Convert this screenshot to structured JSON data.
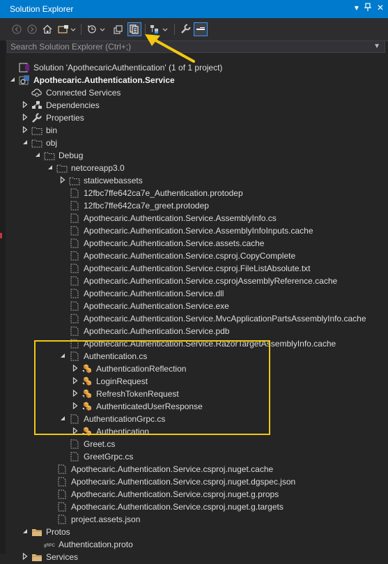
{
  "window": {
    "title": "Solution Explorer",
    "title_icons": [
      "dropdown-icon",
      "pin-icon",
      "close-icon"
    ]
  },
  "toolbar": {
    "items": [
      "back-icon",
      "forward-icon",
      "home-icon",
      "switch-views-icon",
      "pending-changes-filter-icon",
      "sync-with-active-document-icon",
      "collapse-all-icon",
      "show-all-files-icon",
      "properties-icon",
      "preview-selected-items-icon"
    ],
    "active_item": "show-all-files-icon"
  },
  "search": {
    "placeholder": "Search Solution Explorer (Ctrl+;)"
  },
  "tree": [
    {
      "label": "Solution 'ApothecaricAuthentication' (1 of 1 project)",
      "icon": "solution-icon",
      "expander": "none",
      "bold": false
    },
    {
      "label": "Apothecaric.Authentication.Service",
      "icon": "csharp-project-icon",
      "expander": "expanded",
      "bold": true
    },
    {
      "label": "Connected Services",
      "icon": "connected-services-icon",
      "expander": "none",
      "bold": false
    },
    {
      "label": "Dependencies",
      "icon": "dependencies-icon",
      "expander": "collapsed",
      "bold": false
    },
    {
      "label": "Properties",
      "icon": "wrench-icon",
      "expander": "collapsed",
      "bold": false
    },
    {
      "label": "bin",
      "icon": "folder-outline-icon",
      "expander": "collapsed",
      "bold": false
    },
    {
      "label": "obj",
      "icon": "folder-outline-icon",
      "expander": "expanded",
      "bold": false
    },
    {
      "label": "Debug",
      "icon": "folder-outline-icon",
      "expander": "expanded",
      "bold": false
    },
    {
      "label": "netcoreapp3.0",
      "icon": "folder-outline-icon",
      "expander": "expanded",
      "bold": false
    },
    {
      "label": "staticwebassets",
      "icon": "folder-outline-icon",
      "expander": "collapsed",
      "bold": false
    },
    {
      "label": "12fbc7ffe642ca7e_Authentication.protodep",
      "icon": "file-outline-icon",
      "expander": "none",
      "bold": false
    },
    {
      "label": "12fbc7ffe642ca7e_greet.protodep",
      "icon": "file-outline-icon",
      "expander": "none",
      "bold": false
    },
    {
      "label": "Apothecaric.Authentication.Service.AssemblyInfo.cs",
      "icon": "file-outline-icon",
      "expander": "none",
      "bold": false
    },
    {
      "label": "Apothecaric.Authentication.Service.AssemblyInfoInputs.cache",
      "icon": "file-outline-icon",
      "expander": "none",
      "bold": false
    },
    {
      "label": "Apothecaric.Authentication.Service.assets.cache",
      "icon": "file-outline-icon",
      "expander": "none",
      "bold": false
    },
    {
      "label": "Apothecaric.Authentication.Service.csproj.CopyComplete",
      "icon": "file-outline-icon",
      "expander": "none",
      "bold": false
    },
    {
      "label": "Apothecaric.Authentication.Service.csproj.FileListAbsolute.txt",
      "icon": "file-outline-icon",
      "expander": "none",
      "bold": false
    },
    {
      "label": "Apothecaric.Authentication.Service.csprojAssemblyReference.cache",
      "icon": "file-outline-icon",
      "expander": "none",
      "bold": false
    },
    {
      "label": "Apothecaric.Authentication.Service.dll",
      "icon": "file-outline-icon",
      "expander": "none",
      "bold": false
    },
    {
      "label": "Apothecaric.Authentication.Service.exe",
      "icon": "file-outline-icon",
      "expander": "none",
      "bold": false
    },
    {
      "label": "Apothecaric.Authentication.Service.MvcApplicationPartsAssemblyInfo.cache",
      "icon": "file-outline-icon",
      "expander": "none",
      "bold": false
    },
    {
      "label": "Apothecaric.Authentication.Service.pdb",
      "icon": "file-outline-icon",
      "expander": "none",
      "bold": false
    },
    {
      "label": "Apothecaric.Authentication.Service.RazorTargetAssemblyInfo.cache",
      "icon": "file-outline-icon",
      "expander": "none",
      "bold": false
    },
    {
      "label": "Authentication.cs",
      "icon": "file-outline-icon",
      "expander": "expanded",
      "bold": false
    },
    {
      "label": "AuthenticationReflection",
      "icon": "class-icon",
      "expander": "collapsed",
      "bold": false
    },
    {
      "label": "LoginRequest",
      "icon": "class-icon",
      "expander": "collapsed",
      "bold": false
    },
    {
      "label": "RefreshTokenRequest",
      "icon": "class-icon",
      "expander": "collapsed",
      "bold": false
    },
    {
      "label": "AuthenticatedUserResponse",
      "icon": "class-icon",
      "expander": "collapsed",
      "bold": false
    },
    {
      "label": "AuthenticationGrpc.cs",
      "icon": "file-outline-icon",
      "expander": "expanded",
      "bold": false
    },
    {
      "label": "Authentication",
      "icon": "class-icon",
      "expander": "collapsed",
      "bold": false
    },
    {
      "label": "Greet.cs",
      "icon": "file-outline-icon",
      "expander": "none",
      "bold": false
    },
    {
      "label": "GreetGrpc.cs",
      "icon": "file-outline-icon",
      "expander": "none",
      "bold": false
    },
    {
      "label": "Apothecaric.Authentication.Service.csproj.nuget.cache",
      "icon": "file-outline-icon",
      "expander": "none",
      "bold": false
    },
    {
      "label": "Apothecaric.Authentication.Service.csproj.nuget.dgspec.json",
      "icon": "file-outline-icon",
      "expander": "none",
      "bold": false
    },
    {
      "label": "Apothecaric.Authentication.Service.csproj.nuget.g.props",
      "icon": "file-outline-icon",
      "expander": "none",
      "bold": false
    },
    {
      "label": "Apothecaric.Authentication.Service.csproj.nuget.g.targets",
      "icon": "file-outline-icon",
      "expander": "none",
      "bold": false
    },
    {
      "label": "project.assets.json",
      "icon": "file-outline-icon",
      "expander": "none",
      "bold": false
    },
    {
      "label": "Protos",
      "icon": "folder-icon",
      "expander": "expanded",
      "bold": false
    },
    {
      "label": "Authentication.proto",
      "icon": "grpc-file-icon",
      "expander": "none",
      "bold": false
    },
    {
      "label": "Services",
      "icon": "folder-icon",
      "expander": "collapsed",
      "bold": false
    }
  ],
  "grpc_badge": "gRPC",
  "colors": {
    "accent": "#007acc",
    "annotation": "#f2c811",
    "background": "#252526",
    "folder": "#dcb67a",
    "class": "#e8a33d",
    "project": "#68217a"
  }
}
